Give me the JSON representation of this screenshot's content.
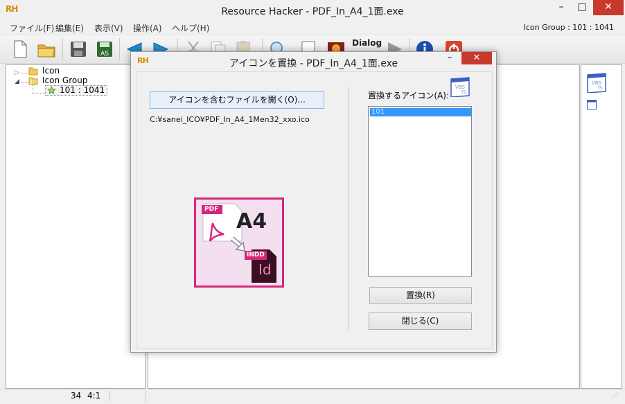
{
  "window": {
    "logo": "RH",
    "title": "Resource Hacker - PDF_In_A4_1面.exe",
    "minimize": "–",
    "maximize": "□",
    "close": "✕"
  },
  "menu": {
    "items": [
      "ファイル(F)",
      "編集(E)",
      "表示(V)",
      "操作(A)",
      "ヘルプ(H)"
    ],
    "status": "Icon Group : 101 : 1041"
  },
  "toolbar": {
    "dialog_label": "Dialog",
    "save_as_label": "AS"
  },
  "tree": {
    "items": [
      {
        "label": "Icon"
      },
      {
        "label": "Icon Group"
      },
      {
        "label": "101 : 1041"
      }
    ]
  },
  "statusbar": {
    "line": "34",
    "col": "4:1"
  },
  "dialog": {
    "logo": "RH",
    "title": "アイコンを置換 - PDF_In_A4_1面.exe",
    "minimize": "–",
    "close": "✕",
    "open_button": "アイコンを含むファイルを開く(O)...",
    "file_path": "C:¥sanei_ICO¥PDF_In_A4_1Men32_xxo.ico",
    "replace_label": "置換するアイコン(A):",
    "list": [
      "101"
    ],
    "replace_button": "置換(R)",
    "close_button": "閉じる(C)"
  },
  "preview_icon": {
    "pdf_badge": "PDF",
    "size": "A4",
    "indd_badge": "INDD",
    "id_text": "Id"
  },
  "colors": {
    "close_red": "#c7392d",
    "selection_blue": "#3399ff",
    "preview_border": "#d6267a"
  }
}
